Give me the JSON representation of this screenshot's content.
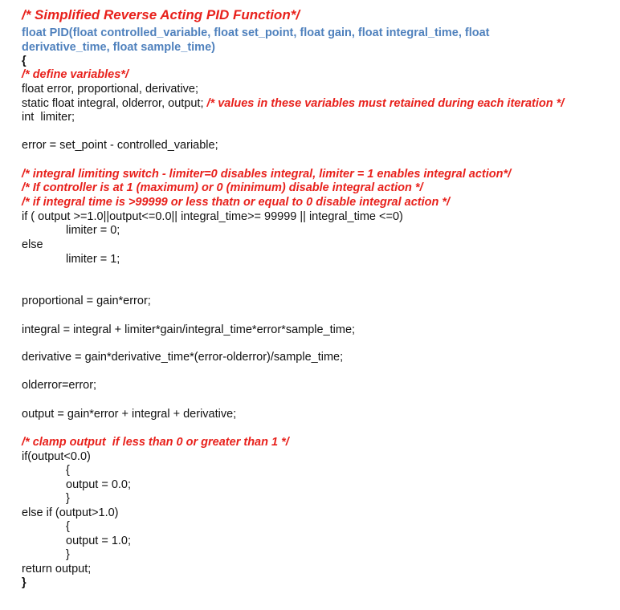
{
  "colors": {
    "comment": "#e8211c",
    "signature": "#4f81bd",
    "code": "#111111"
  },
  "code": {
    "title_comment": "/* Simplified Reverse Acting PID Function*/",
    "signature_line1": "float PID(float controlled_variable, float set_point, float gain, float integral_time, float",
    "signature_line2": "derivative_time, float sample_time)",
    "open_brace": "{",
    "comment_define": "/* define variables*/",
    "decl_float": "float error, proportional, derivative;",
    "decl_static_code": "static float integral, olderror, output; ",
    "decl_static_comment": "/* values in these variables must retained during each iteration */",
    "decl_int": "int  limiter;",
    "error_assign": "error = set_point - controlled_variable;",
    "comment_limiter1": "/* integral limiting switch - limiter=0 disables integral, limiter = 1 enables integral action*/",
    "comment_limiter2": "/* If controller is at 1 (maximum) or 0 (minimum) disable integral action */",
    "comment_limiter3": "/* if integral time is >99999 or less thatn or equal to 0 disable integral action */",
    "if_condition": "if ( output >=1.0||output<=0.0|| integral_time>= 99999 || integral_time <=0)",
    "limiter_zero": "limiter = 0;",
    "else_kw": "else",
    "limiter_one": "limiter = 1;",
    "proportional_assign": "proportional = gain*error;",
    "integral_assign": "integral = integral + limiter*gain/integral_time*error*sample_time;",
    "derivative_assign": "derivative = gain*derivative_time*(error-olderror)/sample_time;",
    "olderror_assign": "olderror=error;",
    "output_assign": "output = gain*error + integral + derivative;",
    "comment_clamp": "/* clamp output  if less than 0 or greater than 1 */",
    "if_low": "if(output<0.0)",
    "brace_open_1": "{",
    "output_zero": "output = 0.0;",
    "brace_close_1": "}",
    "else_if_high": "else if (output>1.0)",
    "brace_open_2": "{",
    "output_one": "output = 1.0;",
    "brace_close_2": "}",
    "return_stmt": "return output;",
    "close_brace": "}"
  }
}
